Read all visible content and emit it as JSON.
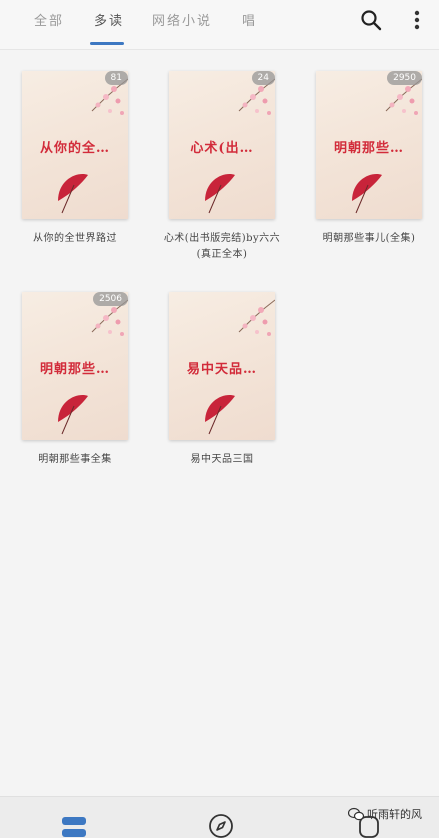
{
  "tabs": [
    {
      "label": "全部"
    },
    {
      "label": "多读"
    },
    {
      "label": "网络小说"
    },
    {
      "label": "唱"
    }
  ],
  "active_tab_index": 1,
  "icons": {
    "search": "search-icon",
    "more": "more-vertical-icon",
    "nav_shelf": "bookshelf-icon",
    "nav_explore": "compass-icon",
    "nav_profile": "profile-icon"
  },
  "colors": {
    "accent": "#3d78c2",
    "cover_title": "#d22b3a",
    "umbrella": "#c8243a"
  },
  "books": [
    {
      "cover_title": "从你的全…",
      "badge": "81",
      "name": "从你的全世界路过"
    },
    {
      "cover_title": "心术(出…",
      "badge": "24",
      "name": "心术(出书版完结)by六六(真正全本)"
    },
    {
      "cover_title": "明朝那些…",
      "badge": "2950",
      "name": "明朝那些事儿(全集)"
    },
    {
      "cover_title": "明朝那些…",
      "badge": "2506",
      "name": "明朝那些事全集"
    },
    {
      "cover_title": "易中天品…",
      "badge": "",
      "name": "易中天品三国"
    }
  ],
  "watermark": {
    "text": "听雨轩的风"
  }
}
